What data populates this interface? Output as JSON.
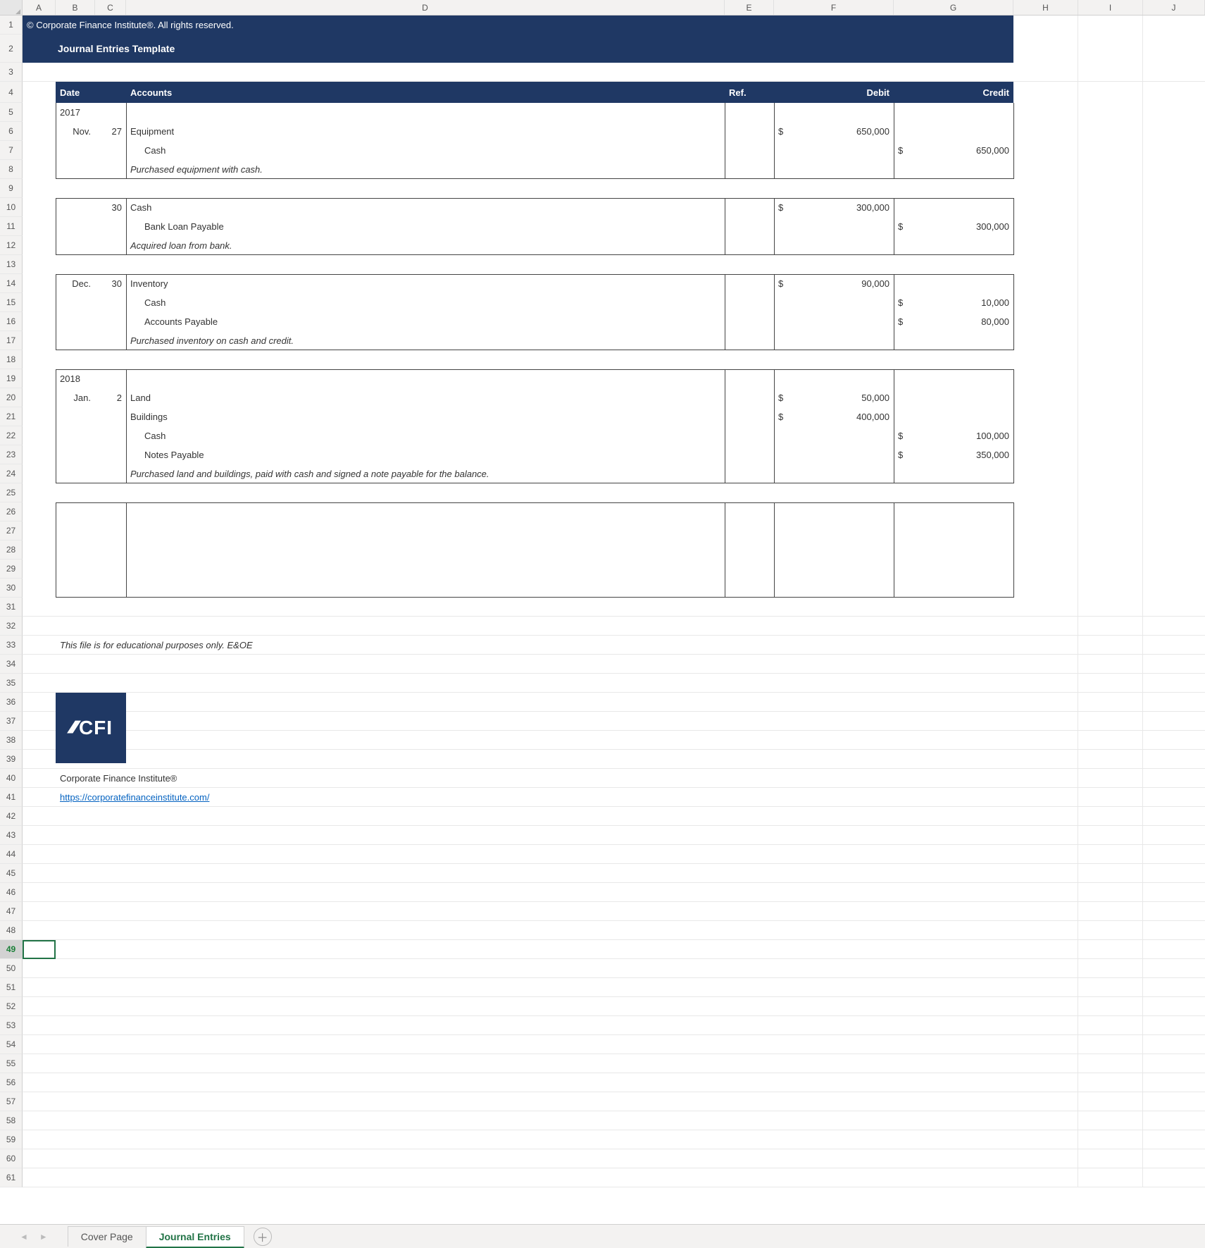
{
  "columns": [
    "A",
    "B",
    "C",
    "D",
    "E",
    "F",
    "G",
    "H",
    "I",
    "J"
  ],
  "row_count": 61,
  "selected_row": 49,
  "banner": {
    "copyright": "© Corporate Finance Institute®. All rights reserved.",
    "title": "Journal Entries Template"
  },
  "table_header": {
    "date": "Date",
    "accounts": "Accounts",
    "ref": "Ref.",
    "debit": "Debit",
    "credit": "Credit"
  },
  "entries": [
    {
      "year": "2017",
      "month": "Nov.",
      "day": "27",
      "lines": [
        {
          "account": "Equipment",
          "debit": "650,000"
        },
        {
          "account": "Cash",
          "indent": true,
          "credit": "650,000"
        }
      ],
      "memo": "Purchased equipment with cash."
    },
    {
      "month": "",
      "day": "30",
      "lines": [
        {
          "account": "Cash",
          "debit": "300,000"
        },
        {
          "account": "Bank Loan Payable",
          "indent": true,
          "credit": "300,000"
        }
      ],
      "memo": "Acquired loan from bank."
    },
    {
      "month": "Dec.",
      "day": "30",
      "lines": [
        {
          "account": "Inventory",
          "debit": "90,000"
        },
        {
          "account": "Cash",
          "indent": true,
          "credit": "10,000"
        },
        {
          "account": "Accounts Payable",
          "indent": true,
          "credit": "80,000"
        }
      ],
      "memo": "Purchased inventory on cash and credit."
    },
    {
      "year": "2018",
      "month": "Jan.",
      "day": "2",
      "lines": [
        {
          "account": "Land",
          "debit": "50,000"
        },
        {
          "account": "Buildings",
          "debit": "400,000"
        },
        {
          "account": "Cash",
          "indent": true,
          "credit": "100,000"
        },
        {
          "account": "Notes Payable",
          "indent": true,
          "credit": "350,000"
        }
      ],
      "memo": "Purchased land and buildings, paid with cash and signed a note payable for the balance."
    }
  ],
  "currency": "$",
  "footer": {
    "disclaimer": "This file is for educational purposes only. E&OE",
    "logo_label": "CFI",
    "org": "Corporate Finance Institute®",
    "url": "https://corporatefinanceinstitute.com/"
  },
  "tabs": {
    "items": [
      "Cover Page",
      "Journal Entries"
    ],
    "active_index": 1
  }
}
